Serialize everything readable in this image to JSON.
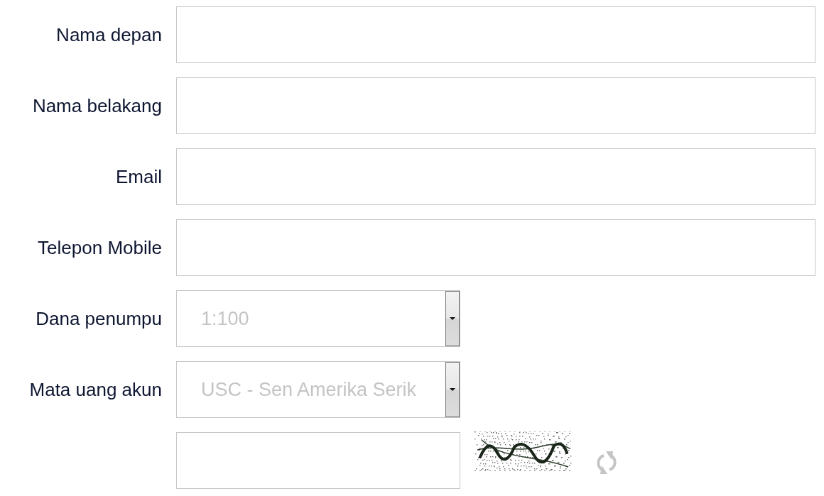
{
  "form": {
    "fields": [
      {
        "kind": "text",
        "label": "Nama depan"
      },
      {
        "kind": "text",
        "label": "Nama belakang"
      },
      {
        "kind": "text",
        "label": "Email"
      },
      {
        "kind": "text",
        "label": "Telepon Mobile"
      },
      {
        "kind": "select",
        "label": "Dana penumpu",
        "value": "1:100"
      },
      {
        "kind": "select",
        "label": "Mata uang akun",
        "value": "USC - Sen Amerika Serik"
      },
      {
        "kind": "captcha"
      }
    ]
  }
}
